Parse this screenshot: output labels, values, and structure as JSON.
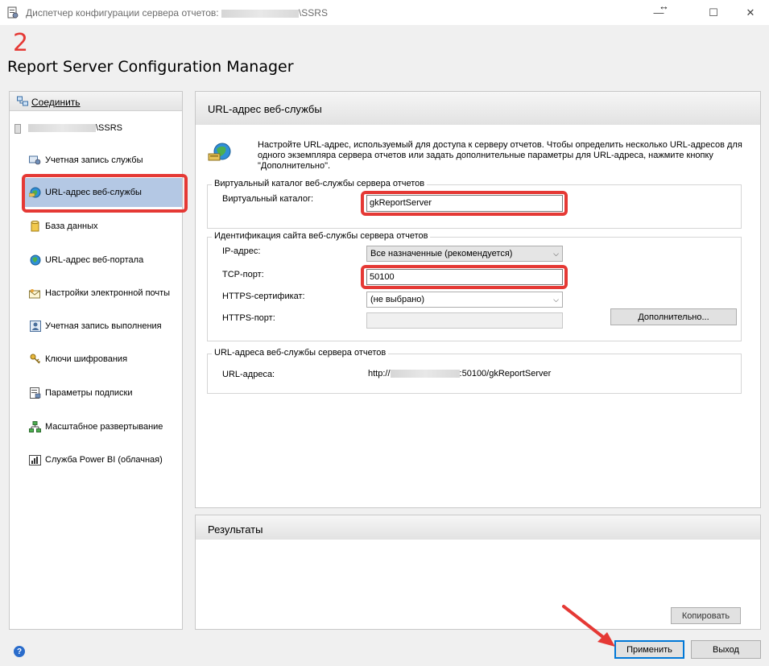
{
  "window": {
    "title_prefix": "Диспетчер конфигурации сервера отчетов: ",
    "title_suffix": "\\SSRS",
    "minimize": "—",
    "maximize": "☐",
    "close": "✕",
    "resize_glyph": "↔"
  },
  "annotation": {
    "step_number": "2",
    "highlight_color": "#e53935"
  },
  "app_title": "Report Server Configuration Manager",
  "sidebar": {
    "connect_label": "Соединить",
    "server_suffix": "\\SSRS",
    "items": [
      {
        "label": "Учетная запись службы",
        "icon": "service-account-icon"
      },
      {
        "label": "URL-адрес веб-службы",
        "icon": "web-service-url-icon",
        "selected": true
      },
      {
        "label": "База данных",
        "icon": "database-icon"
      },
      {
        "label": "URL-адрес веб-портала",
        "icon": "web-portal-globe-icon"
      },
      {
        "label": "Настройки электронной почты",
        "icon": "email-icon"
      },
      {
        "label": "Учетная запись выполнения",
        "icon": "execution-account-icon"
      },
      {
        "label": "Ключи шифрования",
        "icon": "key-icon"
      },
      {
        "label": "Параметры подписки",
        "icon": "subscription-icon"
      },
      {
        "label": "Масштабное развертывание",
        "icon": "scale-out-icon"
      },
      {
        "label": "Служба Power BI (облачная)",
        "icon": "power-bi-icon"
      }
    ],
    "selected_color": "#b4c8e4"
  },
  "main": {
    "title": "URL-адрес веб-службы",
    "description": "Настройте URL-адрес, используемый для доступа к серверу отчетов. Чтобы определить несколько URL-адресов для одного экземпляра сервера отчетов или задать дополнительные параметры для URL-адреса, нажмите кнопку \"Дополнительно\".",
    "virtual_dir_group": {
      "legend": "Виртуальный каталог веб-службы сервера отчетов",
      "label": "Виртуальный каталог:",
      "value": "gkReportServer"
    },
    "site_group": {
      "legend": "Идентификация сайта веб-службы сервера отчетов",
      "ip_label": "IP-адрес:",
      "ip_value": "Все назначенные (рекомендуется)",
      "tcp_label": "TCP-порт:",
      "tcp_value": "50100",
      "https_cert_label": "HTTPS-сертификат:",
      "https_cert_value": "(не выбрано)",
      "https_port_label": "HTTPS-порт:",
      "https_port_value": "",
      "advanced_button": "Дополнительно..."
    },
    "urls_group": {
      "legend": "URL-адреса веб-службы сервера отчетов",
      "label": "URL-адреса:",
      "url_prefix": "http://",
      "url_suffix": ":50100/gkReportServer"
    }
  },
  "results": {
    "title": "Результаты",
    "copy_button": "Копировать"
  },
  "footer": {
    "apply_button": "Применить",
    "exit_button": "Выход",
    "help": "?"
  }
}
